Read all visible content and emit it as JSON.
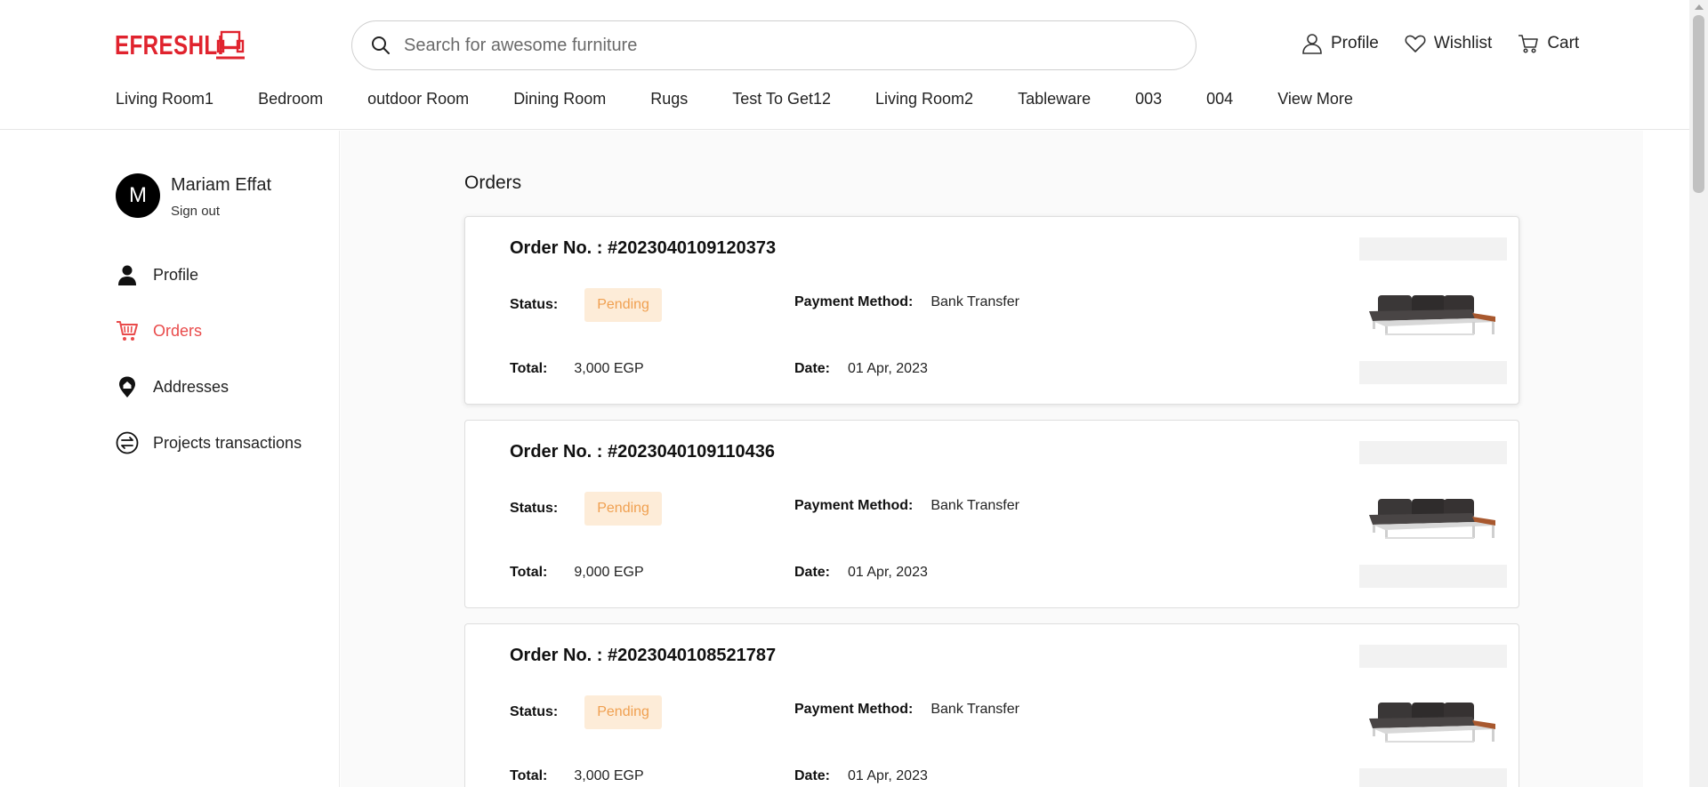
{
  "header": {
    "logo_text": "EFRESHLI",
    "search_placeholder": "Search for awesome furniture",
    "actions": [
      {
        "label": "Profile",
        "icon": "user-icon"
      },
      {
        "label": "Wishlist",
        "icon": "heart-icon"
      },
      {
        "label": "Cart",
        "icon": "cart-icon"
      }
    ],
    "nav": [
      "Living Room1",
      "Bedroom",
      "outdoor Room",
      "Dining Room",
      "Rugs",
      "Test To Get12",
      "Living Room2",
      "Tableware",
      "003",
      "004",
      "View More"
    ]
  },
  "sidebar": {
    "avatar_initial": "M",
    "user_name": "Mariam Effat",
    "sign_out": "Sign out",
    "items": [
      {
        "label": "Profile",
        "icon": "person-icon",
        "active": false
      },
      {
        "label": "Orders",
        "icon": "cart-icon",
        "active": true
      },
      {
        "label": "Addresses",
        "icon": "location-pin-icon",
        "active": false
      },
      {
        "label": "Projects transactions",
        "icon": "transfer-icon",
        "active": false
      }
    ]
  },
  "main": {
    "title": "Orders",
    "labels": {
      "status": "Status:",
      "payment": "Payment Method:",
      "total": "Total:",
      "date": "Date:"
    },
    "orders": [
      {
        "number": "Order No. : #2023040109120373",
        "status": "Pending",
        "payment": "Bank Transfer",
        "total": "3,000 EGP",
        "date": "01 Apr, 2023"
      },
      {
        "number": "Order No. : #2023040109110436",
        "status": "Pending",
        "payment": "Bank Transfer",
        "total": "9,000 EGP",
        "date": "01 Apr, 2023"
      },
      {
        "number": "Order No. : #2023040108521787",
        "status": "Pending",
        "payment": "Bank Transfer",
        "total": "3,000 EGP",
        "date": "01 Apr, 2023"
      }
    ]
  },
  "colors": {
    "brand": "#e0232e",
    "active_menu": "#e94b4b",
    "pending_bg": "#fdecd8",
    "pending_text": "#f0a050"
  }
}
